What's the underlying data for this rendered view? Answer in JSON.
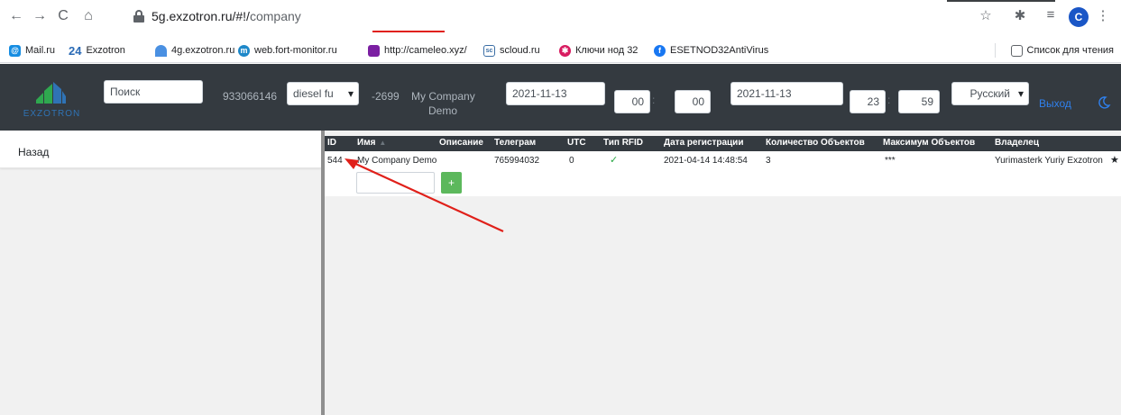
{
  "browser": {
    "url_host": "5g.exzotron.ru/#!/",
    "url_path": "company",
    "profile_initial": "C"
  },
  "bookmarks": [
    {
      "label": "Mail.ru",
      "icon": "mailru-icon",
      "color": "#168de2"
    },
    {
      "label": "Exzotron",
      "icon": "24-icon",
      "color": "#2a6ab5"
    },
    {
      "label": "4g.exzotron.ru",
      "icon": "4g-icon",
      "color": "#4a90e2"
    },
    {
      "label": "web.fort-monitor.ru",
      "icon": "fort-icon",
      "color": "#1e88c9"
    },
    {
      "label": "http://cameleo.xyz/",
      "icon": "cameleo-icon",
      "color": "#7b1fa2"
    },
    {
      "label": "scloud.ru",
      "icon": "scloud-icon",
      "color": "#3b6ea5"
    },
    {
      "label": "Ключи нод 32",
      "icon": "keys-icon",
      "color": "#d81b60"
    },
    {
      "label": "ESETNOD32AntiVirus",
      "icon": "facebook-icon",
      "color": "#1877f2"
    }
  ],
  "reading_list": "Список для чтения",
  "header": {
    "logo_text": "EXZOTRON",
    "search_placeholder": "Поиск",
    "phone": "933066146",
    "fuel_select": "diesel fu",
    "balance": "-2699",
    "company_line1": "My Company",
    "company_line2": "Demo",
    "date_from": "2021-11-13",
    "hour_from": "00",
    "minute_from": "00",
    "date_to": "2021-11-13",
    "hour_to": "23",
    "minute_to": "59",
    "language": "Русский",
    "logout": "Выход"
  },
  "sidebar": {
    "back_label": "Назад"
  },
  "table": {
    "columns": [
      "ID",
      "Имя",
      "Описание",
      "Телеграм",
      "UTC",
      "Тип RFID",
      "Дата регистрации",
      "Количество Объектов",
      "Максимум Объектов",
      "Владелец"
    ],
    "rows": [
      {
        "id": "544",
        "name": "My Company Demo",
        "description": "",
        "telegram": "765994032",
        "utc": "0",
        "rfid": "✓",
        "registered": "2021-04-14 14:48:54",
        "objects_count": "3",
        "objects_max": "***",
        "owner": "Yurimasterk Yuriy Exzotron"
      }
    ],
    "add_button": "+"
  },
  "colors": {
    "header_bg": "#343a40",
    "link_blue": "#2f80ed",
    "annotation_red": "#e0201a",
    "add_green": "#5cb85c"
  }
}
